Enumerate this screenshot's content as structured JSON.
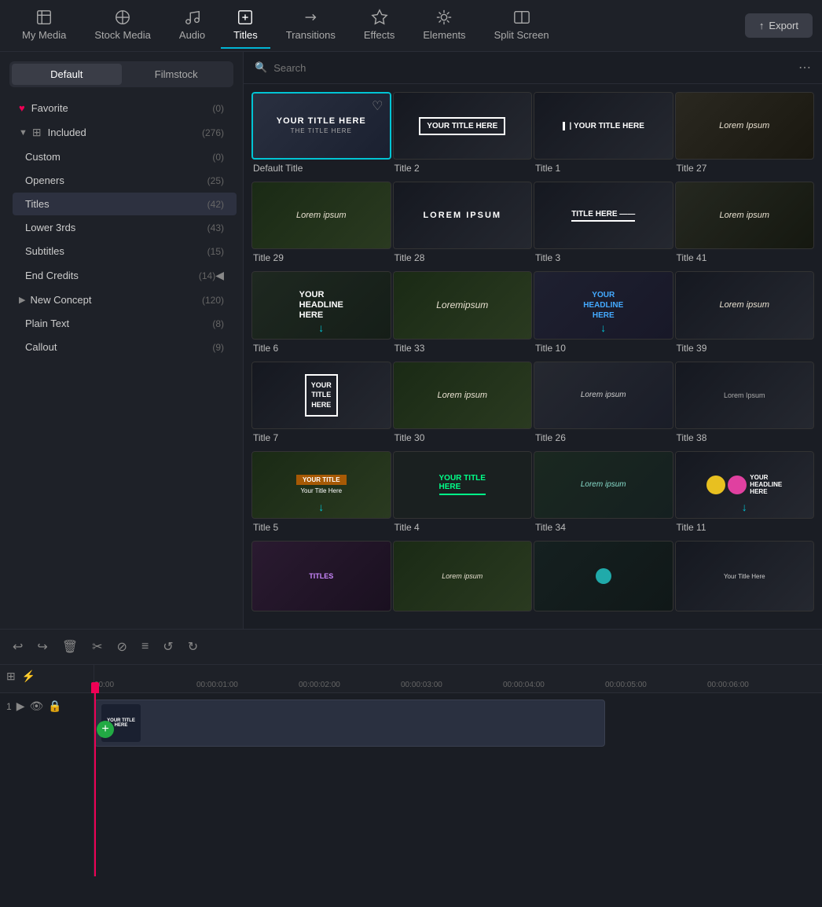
{
  "nav": {
    "items": [
      {
        "id": "my-media",
        "label": "My Media",
        "icon": "photo"
      },
      {
        "id": "stock-media",
        "label": "Stock Media",
        "icon": "stock"
      },
      {
        "id": "audio",
        "label": "Audio",
        "icon": "music"
      },
      {
        "id": "titles",
        "label": "Titles",
        "icon": "title",
        "active": true
      },
      {
        "id": "transitions",
        "label": "Transitions",
        "icon": "transitions"
      },
      {
        "id": "effects",
        "label": "Effects",
        "icon": "effects"
      },
      {
        "id": "elements",
        "label": "Elements",
        "icon": "elements"
      },
      {
        "id": "split-screen",
        "label": "Split Screen",
        "icon": "split"
      }
    ],
    "export_label": "Export"
  },
  "sidebar": {
    "tabs": [
      {
        "id": "default",
        "label": "Default",
        "active": true
      },
      {
        "id": "filmstock",
        "label": "Filmstock",
        "active": false
      }
    ],
    "items": [
      {
        "id": "favorite",
        "label": "Favorite",
        "count": "(0)",
        "indent": 0,
        "icon": "heart"
      },
      {
        "id": "included",
        "label": "Included",
        "count": "(276)",
        "indent": 0,
        "icon": "grid",
        "expanded": true
      },
      {
        "id": "custom",
        "label": "Custom",
        "count": "(0)",
        "indent": 1
      },
      {
        "id": "openers",
        "label": "Openers",
        "count": "(25)",
        "indent": 1
      },
      {
        "id": "titles",
        "label": "Titles",
        "count": "(42)",
        "indent": 1,
        "active": true
      },
      {
        "id": "lower3rds",
        "label": "Lower 3rds",
        "count": "(43)",
        "indent": 1
      },
      {
        "id": "subtitles",
        "label": "Subtitles",
        "count": "(15)",
        "indent": 1
      },
      {
        "id": "end-credits",
        "label": "End Credits",
        "count": "(14)",
        "indent": 1
      },
      {
        "id": "new-concept",
        "label": "New Concept",
        "count": "(120)",
        "indent": 0
      },
      {
        "id": "plain-text",
        "label": "Plain Text",
        "count": "(8)",
        "indent": 1
      },
      {
        "id": "callout",
        "label": "Callout",
        "count": "(9)",
        "indent": 1
      }
    ]
  },
  "search": {
    "placeholder": "Search"
  },
  "titles_grid": {
    "items": [
      {
        "id": "default-title",
        "label": "Default Title",
        "style": "default",
        "selected": true,
        "has_heart": true
      },
      {
        "id": "title-2",
        "label": "Title 2",
        "style": "outlined-white"
      },
      {
        "id": "title-1",
        "label": "Title 1",
        "style": "pipe-white"
      },
      {
        "id": "title-27",
        "label": "Title 27",
        "style": "lorem-italic"
      },
      {
        "id": "title-29",
        "label": "Title 29",
        "style": "lorem-field"
      },
      {
        "id": "title-28",
        "label": "Title 28",
        "style": "lorem-ipsum-dark"
      },
      {
        "id": "title-3",
        "label": "Title 3",
        "style": "title-here-line"
      },
      {
        "id": "title-41",
        "label": "Title 41",
        "style": "lorem-ipsum-alt"
      },
      {
        "id": "title-6",
        "label": "Title 6",
        "style": "headline-big",
        "has_arrow": true
      },
      {
        "id": "title-33",
        "label": "Title 33",
        "style": "lorem-script"
      },
      {
        "id": "title-10",
        "label": "Title 10",
        "style": "headline-blue",
        "has_arrow": true
      },
      {
        "id": "title-39",
        "label": "Title 39",
        "style": "lorem-dark"
      },
      {
        "id": "title-7",
        "label": "Title 7",
        "style": "box-outline"
      },
      {
        "id": "title-30",
        "label": "Title 30",
        "style": "lorem-script-alt"
      },
      {
        "id": "title-26",
        "label": "Title 26",
        "style": "lorem-light"
      },
      {
        "id": "title-38",
        "label": "Title 38",
        "style": "lorem-small"
      },
      {
        "id": "title-5",
        "label": "Title 5",
        "style": "your-title-orange",
        "has_arrow": true
      },
      {
        "id": "title-4",
        "label": "Title 4",
        "style": "title-green"
      },
      {
        "id": "title-34",
        "label": "Title 34",
        "style": "lorem-teal"
      },
      {
        "id": "title-11",
        "label": "Title 11",
        "style": "headline-colorful",
        "has_arrow": true
      },
      {
        "id": "title-row5-1",
        "label": "",
        "style": "partial"
      },
      {
        "id": "title-row5-2",
        "label": "",
        "style": "partial"
      },
      {
        "id": "title-row5-3",
        "label": "",
        "style": "partial"
      },
      {
        "id": "title-row5-4",
        "label": "",
        "style": "partial"
      }
    ]
  },
  "timeline": {
    "ruler_marks": [
      "00:00",
      "00:00:01:00",
      "00:00:02:00",
      "00:00:03:00",
      "00:00:04:00",
      "00:00:05:00",
      "00:00:06:00"
    ],
    "controls": [
      "undo",
      "redo",
      "delete",
      "cut",
      "no-cut",
      "align",
      "rotate-left",
      "rotate-right"
    ],
    "clip_text": "YOUR TITLE HERE",
    "layer_number": "1"
  }
}
